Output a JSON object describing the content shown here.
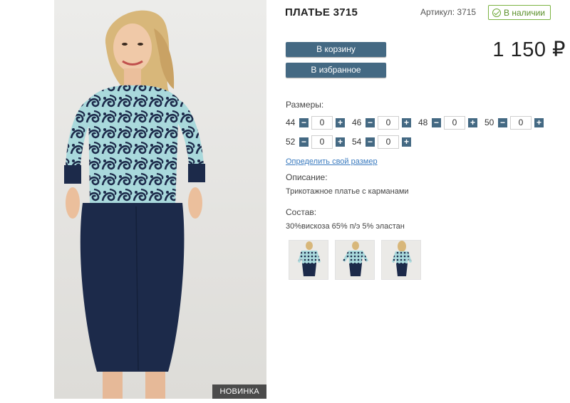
{
  "product": {
    "title": "ПЛАТЬЕ 3715",
    "article": "Артикул: 3715",
    "stock": "В наличии",
    "price": "1 150 ₽",
    "badge": "НОВИНКА"
  },
  "buttons": {
    "cart": "В корзину",
    "favorite": "В избранное"
  },
  "sizes": {
    "label": "Размеры:",
    "items": [
      {
        "size": "44",
        "qty": "0"
      },
      {
        "size": "46",
        "qty": "0"
      },
      {
        "size": "48",
        "qty": "0"
      },
      {
        "size": "50",
        "qty": "0"
      },
      {
        "size": "52",
        "qty": "0"
      },
      {
        "size": "54",
        "qty": "0"
      }
    ],
    "minus": "−",
    "plus": "+"
  },
  "size_link": "Определить свой размер",
  "description": {
    "label": "Описание:",
    "text": "Трикотажное платье с карманами"
  },
  "composition": {
    "label": "Состав:",
    "text": "30%вискоза 65% п/э 5% эластан"
  },
  "colors": {
    "accent": "#446983",
    "stock": "#7cb342",
    "link": "#3b7bbf",
    "dress_navy": "#1c2a4a",
    "dress_mint": "#a9d9dc"
  }
}
